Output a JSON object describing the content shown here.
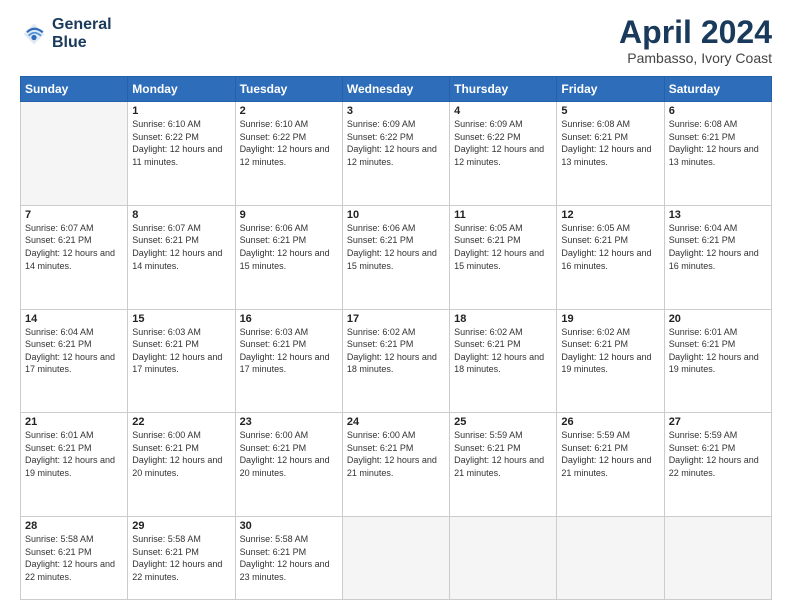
{
  "header": {
    "logo_line1": "General",
    "logo_line2": "Blue",
    "month": "April 2024",
    "location": "Pambasso, Ivory Coast"
  },
  "days_of_week": [
    "Sunday",
    "Monday",
    "Tuesday",
    "Wednesday",
    "Thursday",
    "Friday",
    "Saturday"
  ],
  "weeks": [
    [
      {
        "day": "",
        "empty": true
      },
      {
        "day": "1",
        "sunrise": "6:10 AM",
        "sunset": "6:22 PM",
        "daylight": "12 hours and 11 minutes."
      },
      {
        "day": "2",
        "sunrise": "6:10 AM",
        "sunset": "6:22 PM",
        "daylight": "12 hours and 12 minutes."
      },
      {
        "day": "3",
        "sunrise": "6:09 AM",
        "sunset": "6:22 PM",
        "daylight": "12 hours and 12 minutes."
      },
      {
        "day": "4",
        "sunrise": "6:09 AM",
        "sunset": "6:22 PM",
        "daylight": "12 hours and 12 minutes."
      },
      {
        "day": "5",
        "sunrise": "6:08 AM",
        "sunset": "6:21 PM",
        "daylight": "12 hours and 13 minutes."
      },
      {
        "day": "6",
        "sunrise": "6:08 AM",
        "sunset": "6:21 PM",
        "daylight": "12 hours and 13 minutes."
      }
    ],
    [
      {
        "day": "7",
        "sunrise": "6:07 AM",
        "sunset": "6:21 PM",
        "daylight": "12 hours and 14 minutes."
      },
      {
        "day": "8",
        "sunrise": "6:07 AM",
        "sunset": "6:21 PM",
        "daylight": "12 hours and 14 minutes."
      },
      {
        "day": "9",
        "sunrise": "6:06 AM",
        "sunset": "6:21 PM",
        "daylight": "12 hours and 15 minutes."
      },
      {
        "day": "10",
        "sunrise": "6:06 AM",
        "sunset": "6:21 PM",
        "daylight": "12 hours and 15 minutes."
      },
      {
        "day": "11",
        "sunrise": "6:05 AM",
        "sunset": "6:21 PM",
        "daylight": "12 hours and 15 minutes."
      },
      {
        "day": "12",
        "sunrise": "6:05 AM",
        "sunset": "6:21 PM",
        "daylight": "12 hours and 16 minutes."
      },
      {
        "day": "13",
        "sunrise": "6:04 AM",
        "sunset": "6:21 PM",
        "daylight": "12 hours and 16 minutes."
      }
    ],
    [
      {
        "day": "14",
        "sunrise": "6:04 AM",
        "sunset": "6:21 PM",
        "daylight": "12 hours and 17 minutes."
      },
      {
        "day": "15",
        "sunrise": "6:03 AM",
        "sunset": "6:21 PM",
        "daylight": "12 hours and 17 minutes."
      },
      {
        "day": "16",
        "sunrise": "6:03 AM",
        "sunset": "6:21 PM",
        "daylight": "12 hours and 17 minutes."
      },
      {
        "day": "17",
        "sunrise": "6:02 AM",
        "sunset": "6:21 PM",
        "daylight": "12 hours and 18 minutes."
      },
      {
        "day": "18",
        "sunrise": "6:02 AM",
        "sunset": "6:21 PM",
        "daylight": "12 hours and 18 minutes."
      },
      {
        "day": "19",
        "sunrise": "6:02 AM",
        "sunset": "6:21 PM",
        "daylight": "12 hours and 19 minutes."
      },
      {
        "day": "20",
        "sunrise": "6:01 AM",
        "sunset": "6:21 PM",
        "daylight": "12 hours and 19 minutes."
      }
    ],
    [
      {
        "day": "21",
        "sunrise": "6:01 AM",
        "sunset": "6:21 PM",
        "daylight": "12 hours and 19 minutes."
      },
      {
        "day": "22",
        "sunrise": "6:00 AM",
        "sunset": "6:21 PM",
        "daylight": "12 hours and 20 minutes."
      },
      {
        "day": "23",
        "sunrise": "6:00 AM",
        "sunset": "6:21 PM",
        "daylight": "12 hours and 20 minutes."
      },
      {
        "day": "24",
        "sunrise": "6:00 AM",
        "sunset": "6:21 PM",
        "daylight": "12 hours and 21 minutes."
      },
      {
        "day": "25",
        "sunrise": "5:59 AM",
        "sunset": "6:21 PM",
        "daylight": "12 hours and 21 minutes."
      },
      {
        "day": "26",
        "sunrise": "5:59 AM",
        "sunset": "6:21 PM",
        "daylight": "12 hours and 21 minutes."
      },
      {
        "day": "27",
        "sunrise": "5:59 AM",
        "sunset": "6:21 PM",
        "daylight": "12 hours and 22 minutes."
      }
    ],
    [
      {
        "day": "28",
        "sunrise": "5:58 AM",
        "sunset": "6:21 PM",
        "daylight": "12 hours and 22 minutes."
      },
      {
        "day": "29",
        "sunrise": "5:58 AM",
        "sunset": "6:21 PM",
        "daylight": "12 hours and 22 minutes."
      },
      {
        "day": "30",
        "sunrise": "5:58 AM",
        "sunset": "6:21 PM",
        "daylight": "12 hours and 23 minutes."
      },
      {
        "day": "",
        "empty": true
      },
      {
        "day": "",
        "empty": true
      },
      {
        "day": "",
        "empty": true
      },
      {
        "day": "",
        "empty": true
      }
    ]
  ],
  "labels": {
    "sunrise": "Sunrise:",
    "sunset": "Sunset:",
    "daylight": "Daylight:"
  }
}
